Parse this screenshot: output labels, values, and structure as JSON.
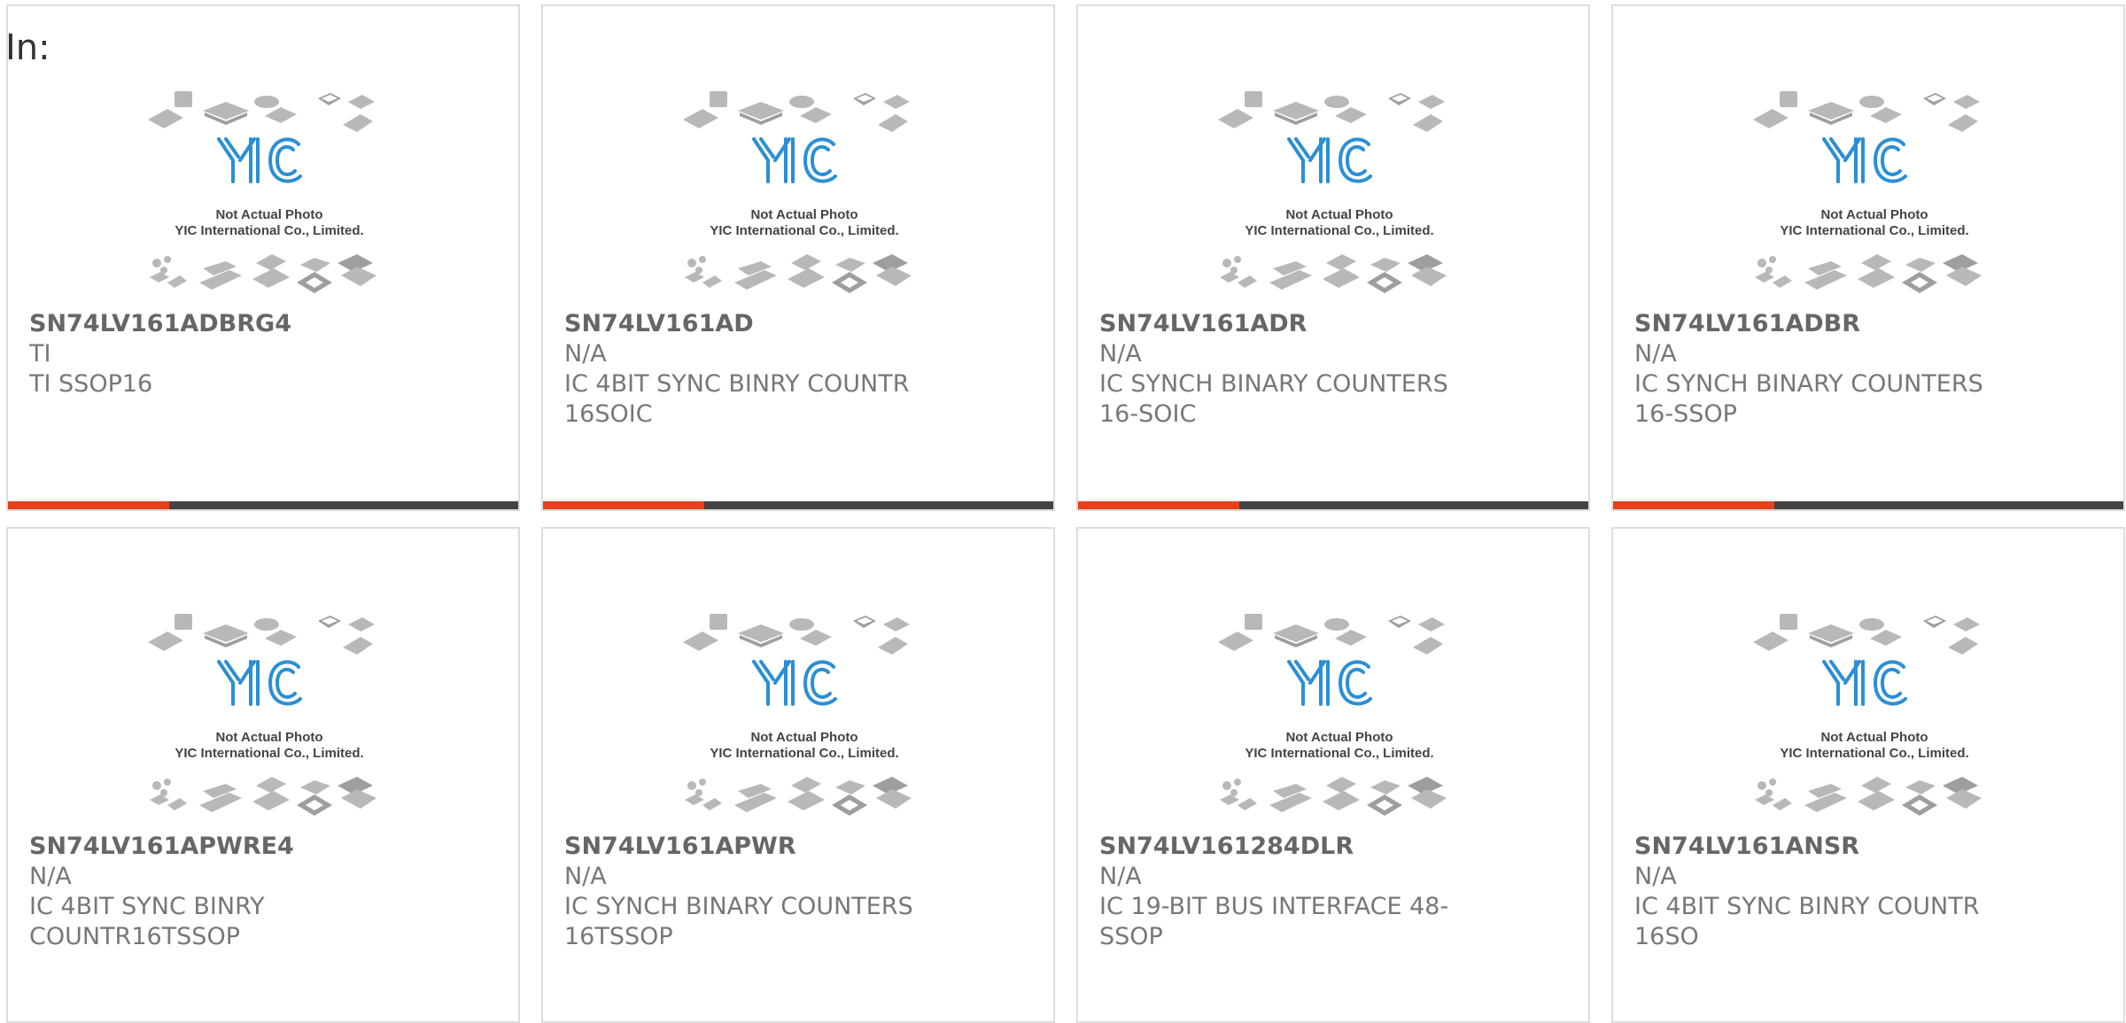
{
  "filter_label": "In:",
  "placeholder": {
    "logo_text": "YIC",
    "caption_line1": "Not Actual Photo",
    "caption_line2": "YIC International Co., Limited."
  },
  "accent_color": "#e8401a",
  "products": [
    {
      "part": "SN74LV161ADBRG4",
      "manufacturer": "TI",
      "description": "TI SSOP16"
    },
    {
      "part": "SN74LV161AD",
      "manufacturer": "N/A",
      "description": "IC 4BIT SYNC BINRY COUNTR 16SOIC"
    },
    {
      "part": "SN74LV161ADR",
      "manufacturer": "N/A",
      "description": "IC SYNCH BINARY COUNTERS 16-SOIC"
    },
    {
      "part": "SN74LV161ADBR",
      "manufacturer": "N/A",
      "description": "IC SYNCH BINARY COUNTERS 16-SSOP"
    },
    {
      "part": "SN74LV161APWRE4",
      "manufacturer": "N/A",
      "description": "IC 4BIT SYNC BINRY COUNTR16TSSOP"
    },
    {
      "part": "SN74LV161APWR",
      "manufacturer": "N/A",
      "description": "IC SYNCH BINARY COUNTERS 16TSSOP"
    },
    {
      "part": "SN74LV161284DLR",
      "manufacturer": "N/A",
      "description": "IC 19-BIT BUS INTERFACE 48-SSOP"
    },
    {
      "part": "SN74LV161ANSR",
      "manufacturer": "N/A",
      "description": "IC 4BIT SYNC BINRY COUNTR 16SO"
    }
  ]
}
